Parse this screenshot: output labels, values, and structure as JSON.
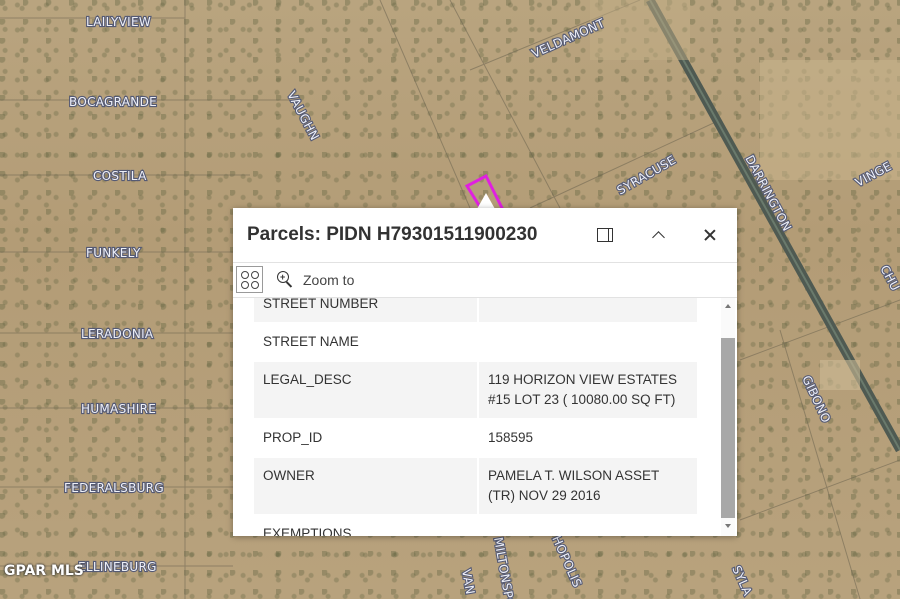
{
  "map": {
    "streets": [
      "LAILYVIEW",
      "BOCAGRANDE",
      "VAUGHN",
      "COSTILA",
      "FUNKELY",
      "LERADONIA",
      "HUMASHIRE",
      "FEDERALSBURG",
      "ELLINEBURG",
      "VELDAMONT",
      "SYRACUSE",
      "DARRINGTON",
      "VINGE",
      "CHU",
      "GIBONO",
      "HOPOLIS",
      "MILTONSPO",
      "VAN",
      "SYLA"
    ],
    "watermark": "GPAR MLS",
    "parcel_highlight_color": "#e020e0"
  },
  "popup": {
    "title": "Parcels: PIDN H79301511900230",
    "dock_icon": "dock-icon",
    "collapse_icon": "chevron-up-icon",
    "close_icon": "close-icon",
    "menu_icon": "actions-menu-icon",
    "zoom_to_label": "Zoom to",
    "attributes": [
      {
        "key": "STREET NUMBER",
        "value": ""
      },
      {
        "key": "STREET NAME",
        "value": ""
      },
      {
        "key": "LEGAL_DESC",
        "value": "119 HORIZON VIEW ESTATES #15 LOT 23 ( 10080.00 SQ FT)"
      },
      {
        "key": "PROP_ID",
        "value": "158595"
      },
      {
        "key": "OWNER",
        "value": "PAMELA T. WILSON ASSET (TR) NOV 29 2016"
      },
      {
        "key": "EXEMPTIONS",
        "value": ""
      }
    ]
  }
}
